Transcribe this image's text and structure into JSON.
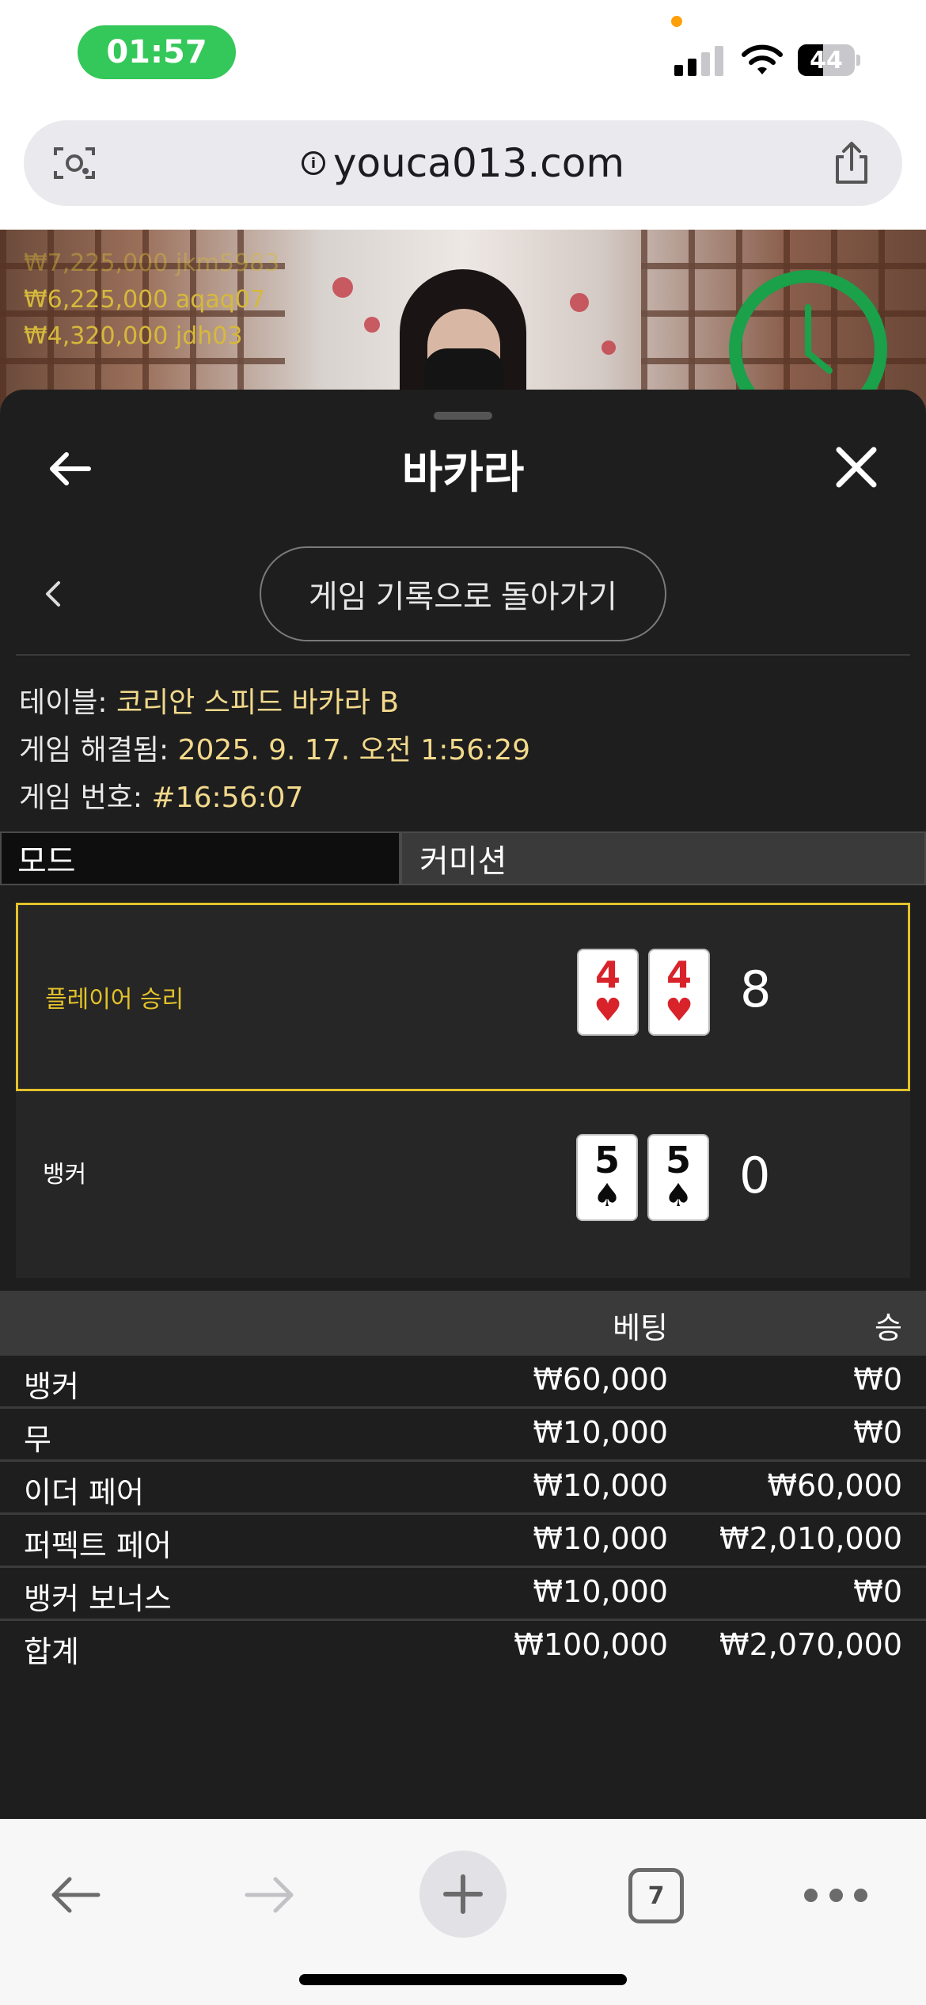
{
  "status": {
    "time": "01:57",
    "battery": "44",
    "battery_level": 0.44
  },
  "browser": {
    "url": "youca013.com"
  },
  "video": {
    "winners": [
      {
        "amount": "₩7,225,000",
        "user": "jkm5983"
      },
      {
        "amount": "₩6,225,000",
        "user": "aqaq07"
      },
      {
        "amount": "₩4,320,000",
        "user": "jdh03"
      }
    ]
  },
  "sheet": {
    "title": "바카라",
    "back_to_history": "게임 기록으로 돌아가기",
    "info": {
      "table_label": "테이블: ",
      "table_value": "코리안 스피드 바카라 B",
      "resolved_label": "게임 해결됨: ",
      "resolved_value": "2025. 9. 17. 오전 1:56:29",
      "number_label": "게임 번호: ",
      "number_value": "#16:56:07"
    },
    "mode_label": "모드",
    "mode_value": "커미션",
    "player": {
      "label": "플레이어 승리",
      "cards": [
        {
          "rank": "4",
          "suit": "♥"
        },
        {
          "rank": "4",
          "suit": "♥"
        }
      ],
      "score": "8"
    },
    "banker": {
      "label": "뱅커",
      "cards": [
        {
          "rank": "5",
          "suit": "♠"
        },
        {
          "rank": "5",
          "suit": "♠"
        }
      ],
      "score": "0"
    },
    "table": {
      "col_bet": "베팅",
      "col_win": "승",
      "rows": [
        {
          "name": "뱅커",
          "bet": "₩60,000",
          "win": "₩0"
        },
        {
          "name": "무",
          "bet": "₩10,000",
          "win": "₩0"
        },
        {
          "name": "이더 페어",
          "bet": "₩10,000",
          "win": "₩60,000"
        },
        {
          "name": "퍼펙트 페어",
          "bet": "₩10,000",
          "win": "₩2,010,000"
        },
        {
          "name": "뱅커 보너스",
          "bet": "₩10,000",
          "win": "₩0"
        }
      ],
      "total": {
        "name": "합계",
        "bet": "₩100,000",
        "win": "₩2,070,000"
      }
    }
  },
  "toolbar": {
    "tab_count": "7"
  },
  "colors": {
    "highlight": "#e3c22a",
    "info_value": "#f2d98b",
    "status_green": "#34c759",
    "sheet_bg": "#1e1e1e"
  },
  "icons": [
    "camera-search-icon",
    "info-icon",
    "share-icon",
    "back-arrow-icon",
    "close-icon",
    "chevron-left-icon",
    "heart-suit-icon",
    "spade-suit-icon",
    "toolbar-back-icon",
    "toolbar-forward-icon",
    "plus-icon",
    "tabs-icon",
    "more-icon"
  ]
}
